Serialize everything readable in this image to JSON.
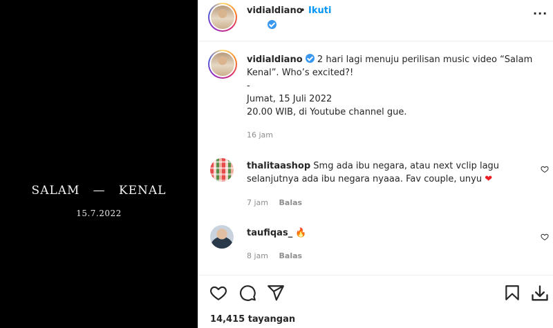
{
  "media": {
    "title_left": "SALAM",
    "title_dash": "—",
    "title_right": "KENAL",
    "date": "15.7.2022"
  },
  "header": {
    "username": "vidialdiano",
    "separator": "•",
    "follow_label": "Ikuti",
    "more_label": "···"
  },
  "caption": {
    "username": "vidialdiano",
    "line1": "2 hari lagi menuju perilisan music video “Salam",
    "line2": "Kenal”. Who’s excited?!",
    "line3": "-",
    "line4": "Jumat, 15 Juli 2022",
    "line5": "20.00 WIB, di Youtube channel gue.",
    "time": "16 jam"
  },
  "comments": [
    {
      "username": "thalitaashop",
      "line1": "Smg ada ibu negara, atau next vclip lagu",
      "line2": "selanjutnya ada ibu negara nyaaa. Fav couple, unyu",
      "emoji": "❤️",
      "time": "7 jam",
      "reply_label": "Balas"
    },
    {
      "username": "taufiqas_",
      "emoji": "🔥",
      "time": "8 jam",
      "reply_label": "Balas"
    }
  ],
  "footer": {
    "views": "14,415 tayangan"
  },
  "icons": {
    "like": "heart-icon",
    "comment": "comment-icon",
    "share": "share-icon",
    "save": "bookmark-icon",
    "download": "download-icon",
    "verified": "verified-badge-icon"
  },
  "colors": {
    "accent": "#0095f6",
    "verified": "#3897f0",
    "heart": "#ed1c24",
    "muted": "#8e8e8e"
  }
}
